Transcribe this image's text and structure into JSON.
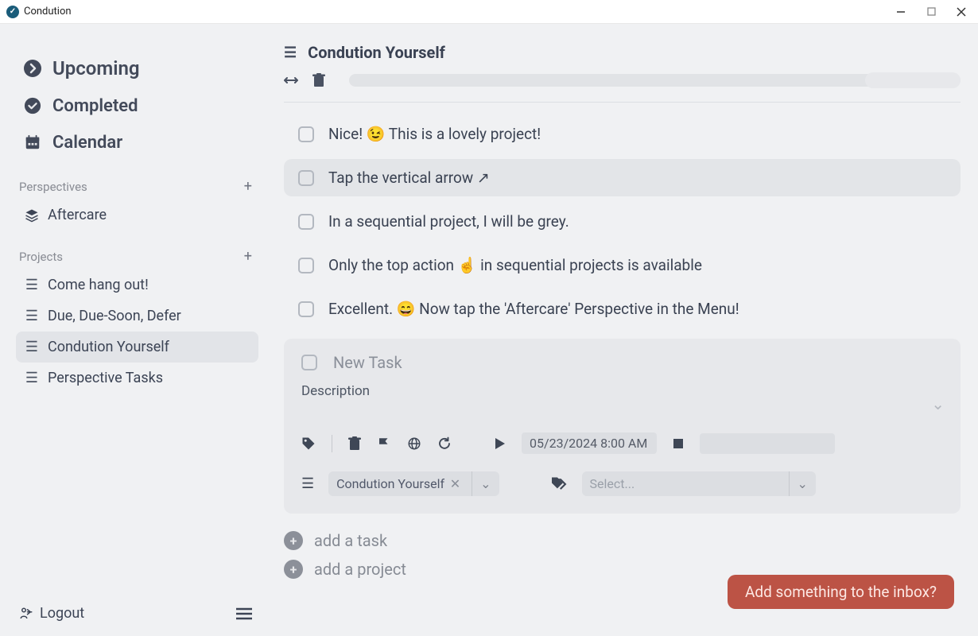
{
  "window": {
    "title": "Condution"
  },
  "sidebar": {
    "nav": {
      "upcoming": "Upcoming",
      "completed": "Completed",
      "calendar": "Calendar"
    },
    "perspectives": {
      "header": "Perspectives",
      "items": [
        "Aftercare"
      ]
    },
    "projects": {
      "header": "Projects",
      "items": [
        "Come hang out!",
        "Due, Due-Soon, Defer",
        "Condution Yourself",
        "Perspective Tasks"
      ],
      "active_index": 2
    },
    "logout": "Logout"
  },
  "main": {
    "title": "Condution Yourself",
    "tasks": [
      {
        "text": "Nice! 😉 This is a lovely project!",
        "highlight": false
      },
      {
        "text": "Tap the vertical arrow ↗",
        "highlight": true
      },
      {
        "text": "In a sequential project, I will be grey.",
        "highlight": false
      },
      {
        "text": "Only the top action ☝️ in sequential projects is available",
        "highlight": false
      },
      {
        "text": "Excellent. 😄 Now tap the 'Aftercare' Perspective in the Menu!",
        "highlight": false
      }
    ],
    "new_task": {
      "title_placeholder": "New Task",
      "description_label": "Description",
      "start_date": "05/23/2024 8:00 AM",
      "project_select": "Condution Yourself",
      "tag_placeholder": "Select..."
    },
    "add_task": "add a task",
    "add_project": "add a project",
    "inbox_prompt": "Add something to the inbox?"
  }
}
